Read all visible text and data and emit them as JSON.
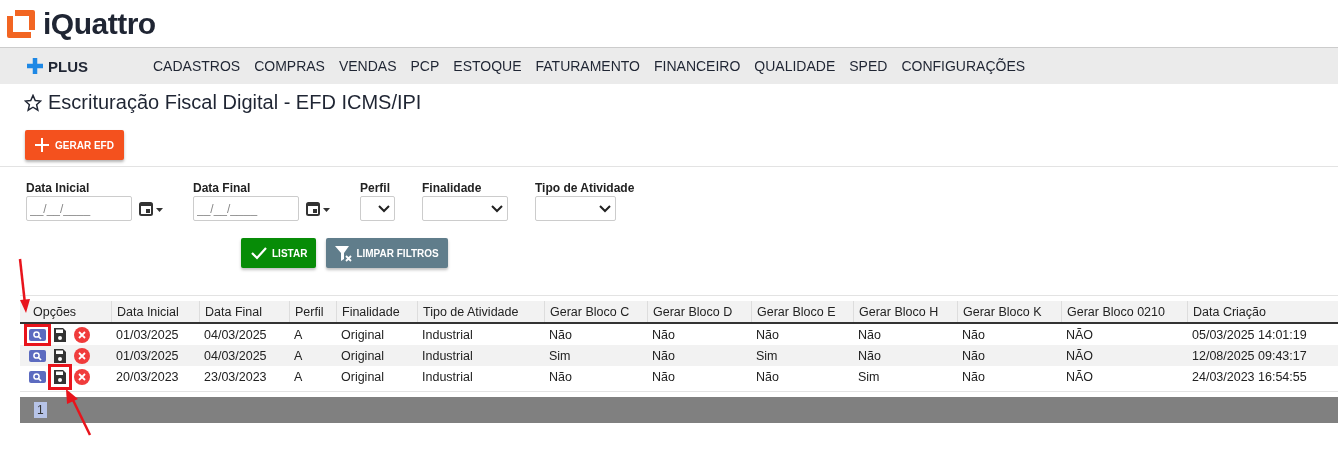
{
  "brand": {
    "name": "iQuattro"
  },
  "nav": {
    "plus_label": "PLUS",
    "items": [
      "CADASTROS",
      "COMPRAS",
      "VENDAS",
      "PCP",
      "ESTOQUE",
      "FATURAMENTO",
      "FINANCEIRO",
      "QUALIDADE",
      "SPED",
      "CONFIGURAÇÕES"
    ]
  },
  "page": {
    "title": "Escrituração Fiscal Digital - EFD ICMS/IPI",
    "favorite": false,
    "primary_button": "GERAR EFD"
  },
  "filters": [
    {
      "kind": "date",
      "label": "Data Inicial",
      "placeholder": "__/__/____"
    },
    {
      "kind": "date",
      "label": "Data Final",
      "placeholder": "__/__/____"
    },
    {
      "kind": "select",
      "label": "Perfil"
    },
    {
      "kind": "select",
      "label": "Finalidade"
    },
    {
      "kind": "select",
      "label": "Tipo de Atividade"
    }
  ],
  "filter_buttons": [
    {
      "kind": "list",
      "label": "LISTAR"
    },
    {
      "kind": "clear",
      "label": "LIMPAR FILTROS"
    }
  ],
  "table": {
    "columns": [
      "Opções",
      "Data Inicial",
      "Data Final",
      "Perfil",
      "Finalidade",
      "Tipo de Atividade",
      "Gerar Bloco C",
      "Gerar Bloco D",
      "Gerar Bloco E",
      "Gerar Bloco H",
      "Gerar Bloco K",
      "Gerar Bloco 0210",
      "Data Criação"
    ],
    "rows": [
      {
        "view_highlighted": true,
        "save_highlighted": false,
        "cells": [
          "",
          "01/03/2025",
          "04/03/2025",
          "A",
          "Original",
          "Industrial",
          "Não",
          "Não",
          "Não",
          "Não",
          "Não",
          "NÃO",
          "05/03/2025 14:01:19"
        ]
      },
      {
        "view_highlighted": false,
        "save_highlighted": false,
        "cells": [
          "",
          "01/03/2025",
          "04/03/2025",
          "A",
          "Original",
          "Industrial",
          "Sim",
          "Não",
          "Sim",
          "Não",
          "Não",
          "NÃO",
          "12/08/2025 09:43:17"
        ]
      },
      {
        "view_highlighted": false,
        "save_highlighted": true,
        "cells": [
          "",
          "20/03/2023",
          "23/03/2023",
          "A",
          "Original",
          "Industrial",
          "Não",
          "Não",
          "Não",
          "Sim",
          "Não",
          "NÃO",
          "24/03/2023 16:54:55"
        ]
      }
    ]
  },
  "pagination": {
    "pages": [
      {
        "label": "1",
        "selected": true
      }
    ]
  }
}
